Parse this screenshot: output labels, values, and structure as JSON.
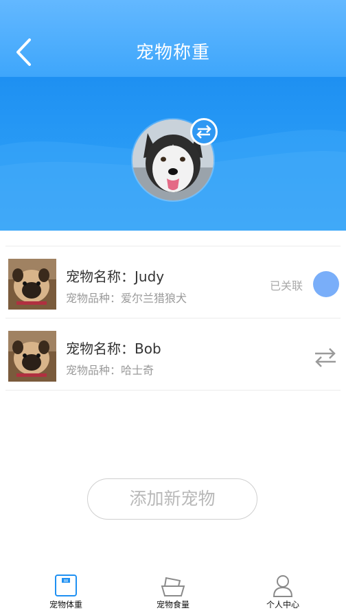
{
  "header": {
    "title": "宠物称重"
  },
  "colors": {
    "primary": "#1e90f2",
    "header_light": "#63b8ff",
    "linked_dot": "#79aef9"
  },
  "current_pet": {
    "avatar": "husky-photo"
  },
  "pets": [
    {
      "name": "宠物名称：Judy",
      "breed": "宠物品种：爱尔兰猎狼犬",
      "status": "已关联",
      "thumbnail": "pug-photo"
    },
    {
      "name": "宠物名称：Bob",
      "breed": "宠物品种：哈士奇",
      "action_icon": "switch-arrows-icon",
      "thumbnail": "pug-photo"
    }
  ],
  "add_button": "添加新宠物",
  "tabs": [
    {
      "label": "宠物体重",
      "icon": "scale-icon",
      "active": true
    },
    {
      "label": "宠物食量",
      "icon": "food-bowl-icon",
      "active": false
    },
    {
      "label": "个人中心",
      "icon": "person-icon",
      "active": false
    }
  ]
}
